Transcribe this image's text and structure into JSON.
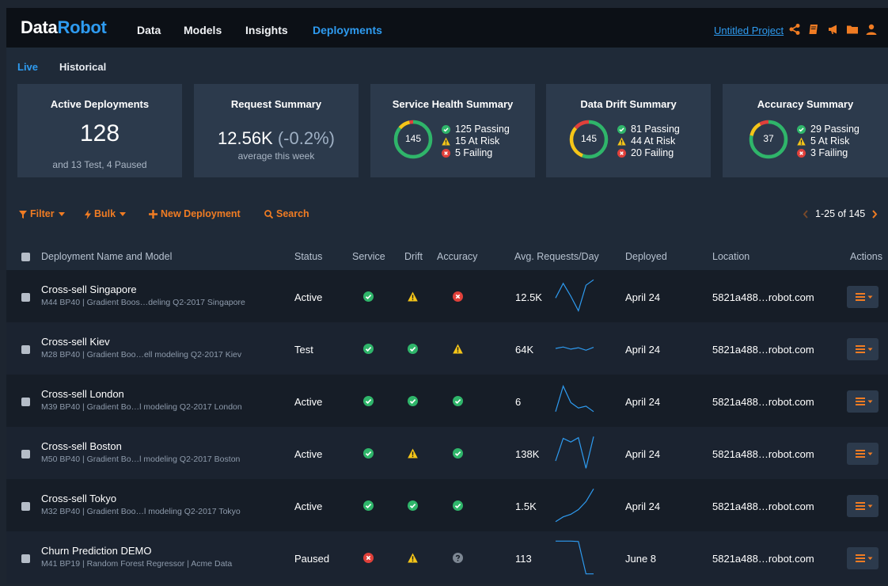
{
  "colors": {
    "accent_blue": "#2e9bf0",
    "accent_orange": "#f07c23",
    "pass_green": "#2fb56a",
    "risk_yellow": "#f5c518",
    "fail_red": "#e0403a",
    "unknown_gray": "#7d8793"
  },
  "topbar": {
    "logo_data": "Data",
    "logo_robot": "Robot",
    "nav": [
      "Data",
      "Models",
      "Insights",
      "Deployments"
    ],
    "active_nav": "Deployments",
    "project_link": "Untitled Project",
    "icons": [
      "share-icon",
      "book-icon",
      "megaphone-icon",
      "folder-icon",
      "user-icon"
    ]
  },
  "subtabs": {
    "live": "Live",
    "historical": "Historical",
    "active": "Live"
  },
  "summary": {
    "active_deployments": {
      "title": "Active Deployments",
      "value": "128",
      "sub": "and 13 Test, 4 Paused"
    },
    "request_summary": {
      "title": "Request Summary",
      "value": "12.56K",
      "change": "(-0.2%)",
      "sub": "average this week"
    },
    "service_health": {
      "title": "Service Health Summary",
      "total": "145",
      "passing": "125 Passing",
      "at_risk": "15 At Risk",
      "failing": "5 Failing",
      "counts": [
        125,
        15,
        5
      ]
    },
    "data_drift": {
      "title": "Data Drift Summary",
      "total": "145",
      "passing": "81 Passing",
      "at_risk": "44 At Risk",
      "failing": "20 Failing",
      "counts": [
        81,
        44,
        20
      ]
    },
    "accuracy": {
      "title": "Accuracy Summary",
      "total": "37",
      "passing": "29 Passing",
      "at_risk": "5 At Risk",
      "failing": "3 Failing",
      "counts": [
        29,
        5,
        3
      ]
    }
  },
  "toolbar": {
    "filter": "Filter",
    "bulk": "Bulk",
    "new_deployment": "New Deployment",
    "search": "Search",
    "pager": "1-25 of 145"
  },
  "table": {
    "headers": {
      "name": "Deployment Name and Model",
      "status": "Status",
      "service": "Service",
      "drift": "Drift",
      "accuracy": "Accuracy",
      "requests": "Avg. Requests/Day",
      "deployed": "Deployed",
      "location": "Location",
      "actions": "Actions"
    },
    "rows": [
      {
        "name": "Cross-sell Singapore",
        "model": "M44  BP40  |  Gradient Boos…deling Q2-2017 Singapore",
        "status": "Active",
        "service": "pass",
        "drift": "risk",
        "accuracy": "fail",
        "requests": "12.5K",
        "spark": [
          0.55,
          0.15,
          0.5,
          0.9,
          0.2,
          0.05
        ],
        "deployed": "April 24",
        "location": "5821a488…robot.com"
      },
      {
        "name": "Cross-sell Kiev",
        "model": "M28  BP40  |  Gradient Boo…ell modeling Q2-2017 Kiev",
        "status": "Test",
        "service": "pass",
        "drift": "pass",
        "accuracy": "risk",
        "requests": "64K",
        "spark": [
          0.5,
          0.46,
          0.52,
          0.48,
          0.55,
          0.47
        ],
        "deployed": "April 24",
        "location": "5821a488…robot.com"
      },
      {
        "name": "Cross-sell London",
        "model": "M39  BP40  |  Gradient Bo…l modeling Q2-2017 London",
        "status": "Active",
        "service": "pass",
        "drift": "pass",
        "accuracy": "pass",
        "requests": "6",
        "spark": [
          0.8,
          0.1,
          0.55,
          0.7,
          0.65,
          0.8
        ],
        "deployed": "April 24",
        "location": "5821a488…robot.com"
      },
      {
        "name": "Cross-sell Boston",
        "model": "M50  BP40  |  Gradient Bo…l modeling Q2-2017 Boston",
        "status": "Active",
        "service": "pass",
        "drift": "risk",
        "accuracy": "pass",
        "requests": "138K",
        "spark": [
          0.72,
          0.1,
          0.2,
          0.08,
          0.92,
          0.05
        ],
        "deployed": "April 24",
        "location": "5821a488…robot.com"
      },
      {
        "name": "Cross-sell Tokyo",
        "model": "M32  BP40  |  Gradient Boo…l modeling Q2-2017 Tokyo",
        "status": "Active",
        "service": "pass",
        "drift": "pass",
        "accuracy": "pass",
        "requests": "1.5K",
        "spark": [
          0.95,
          0.82,
          0.75,
          0.62,
          0.4,
          0.05
        ],
        "deployed": "April 24",
        "location": "5821a488…robot.com"
      },
      {
        "name": "Churn Prediction DEMO",
        "model": "M41  BP19  |  Random Forest Regressor  |  Acme Data",
        "status": "Paused",
        "service": "fail",
        "drift": "risk",
        "accuracy": "unknown",
        "requests": "113",
        "spark": [
          0.05,
          0.05,
          0.05,
          0.06,
          0.95,
          0.95
        ],
        "deployed": "June 8",
        "location": "5821a488…robot.com"
      }
    ]
  }
}
